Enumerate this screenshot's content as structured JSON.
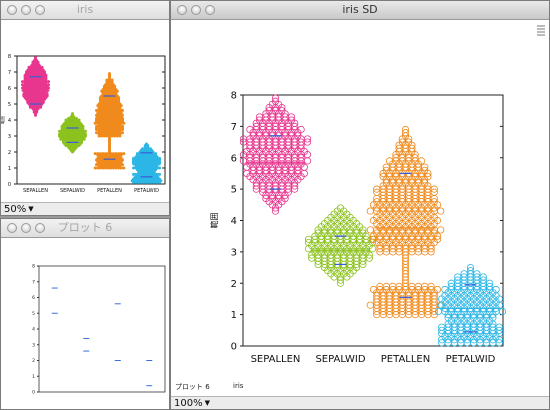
{
  "windows": {
    "iris_small": {
      "title": "iris",
      "zoom": "50%"
    },
    "plot6_small": {
      "title": "プロット 6"
    },
    "iris_sd": {
      "title": "iris SD",
      "zoom": "100%",
      "footer_tab": "プロット 6",
      "footer_name": "iris"
    }
  },
  "chart_data": {
    "type": "scatter",
    "ylabel": "範囲",
    "ylim": [
      0,
      8
    ],
    "yticks": [
      "0",
      "1",
      "2",
      "3",
      "4",
      "5",
      "6",
      "7",
      "8"
    ],
    "categories": [
      "SEPALLEN",
      "SEPALWID",
      "PETALLEN",
      "PETALWID"
    ],
    "colors": [
      "#e8368f",
      "#8cc21e",
      "#f08a1c",
      "#2bb6e6"
    ],
    "ranges": [
      [
        4.3,
        7.9
      ],
      [
        2.0,
        4.4
      ],
      [
        1.0,
        6.9
      ],
      [
        0.1,
        2.5
      ]
    ],
    "mean_lines": [
      5.84,
      3.05,
      3.76,
      1.2
    ],
    "sd_marks": [
      [
        5.0,
        6.7
      ],
      [
        2.6,
        3.5
      ],
      [
        1.55,
        5.5
      ],
      [
        0.45,
        1.95
      ]
    ],
    "small_mean_marks": [
      [
        6.6,
        5.0
      ],
      [
        3.4,
        2.6
      ],
      [
        5.6,
        2.0
      ],
      [
        2.0,
        0.4
      ]
    ]
  }
}
